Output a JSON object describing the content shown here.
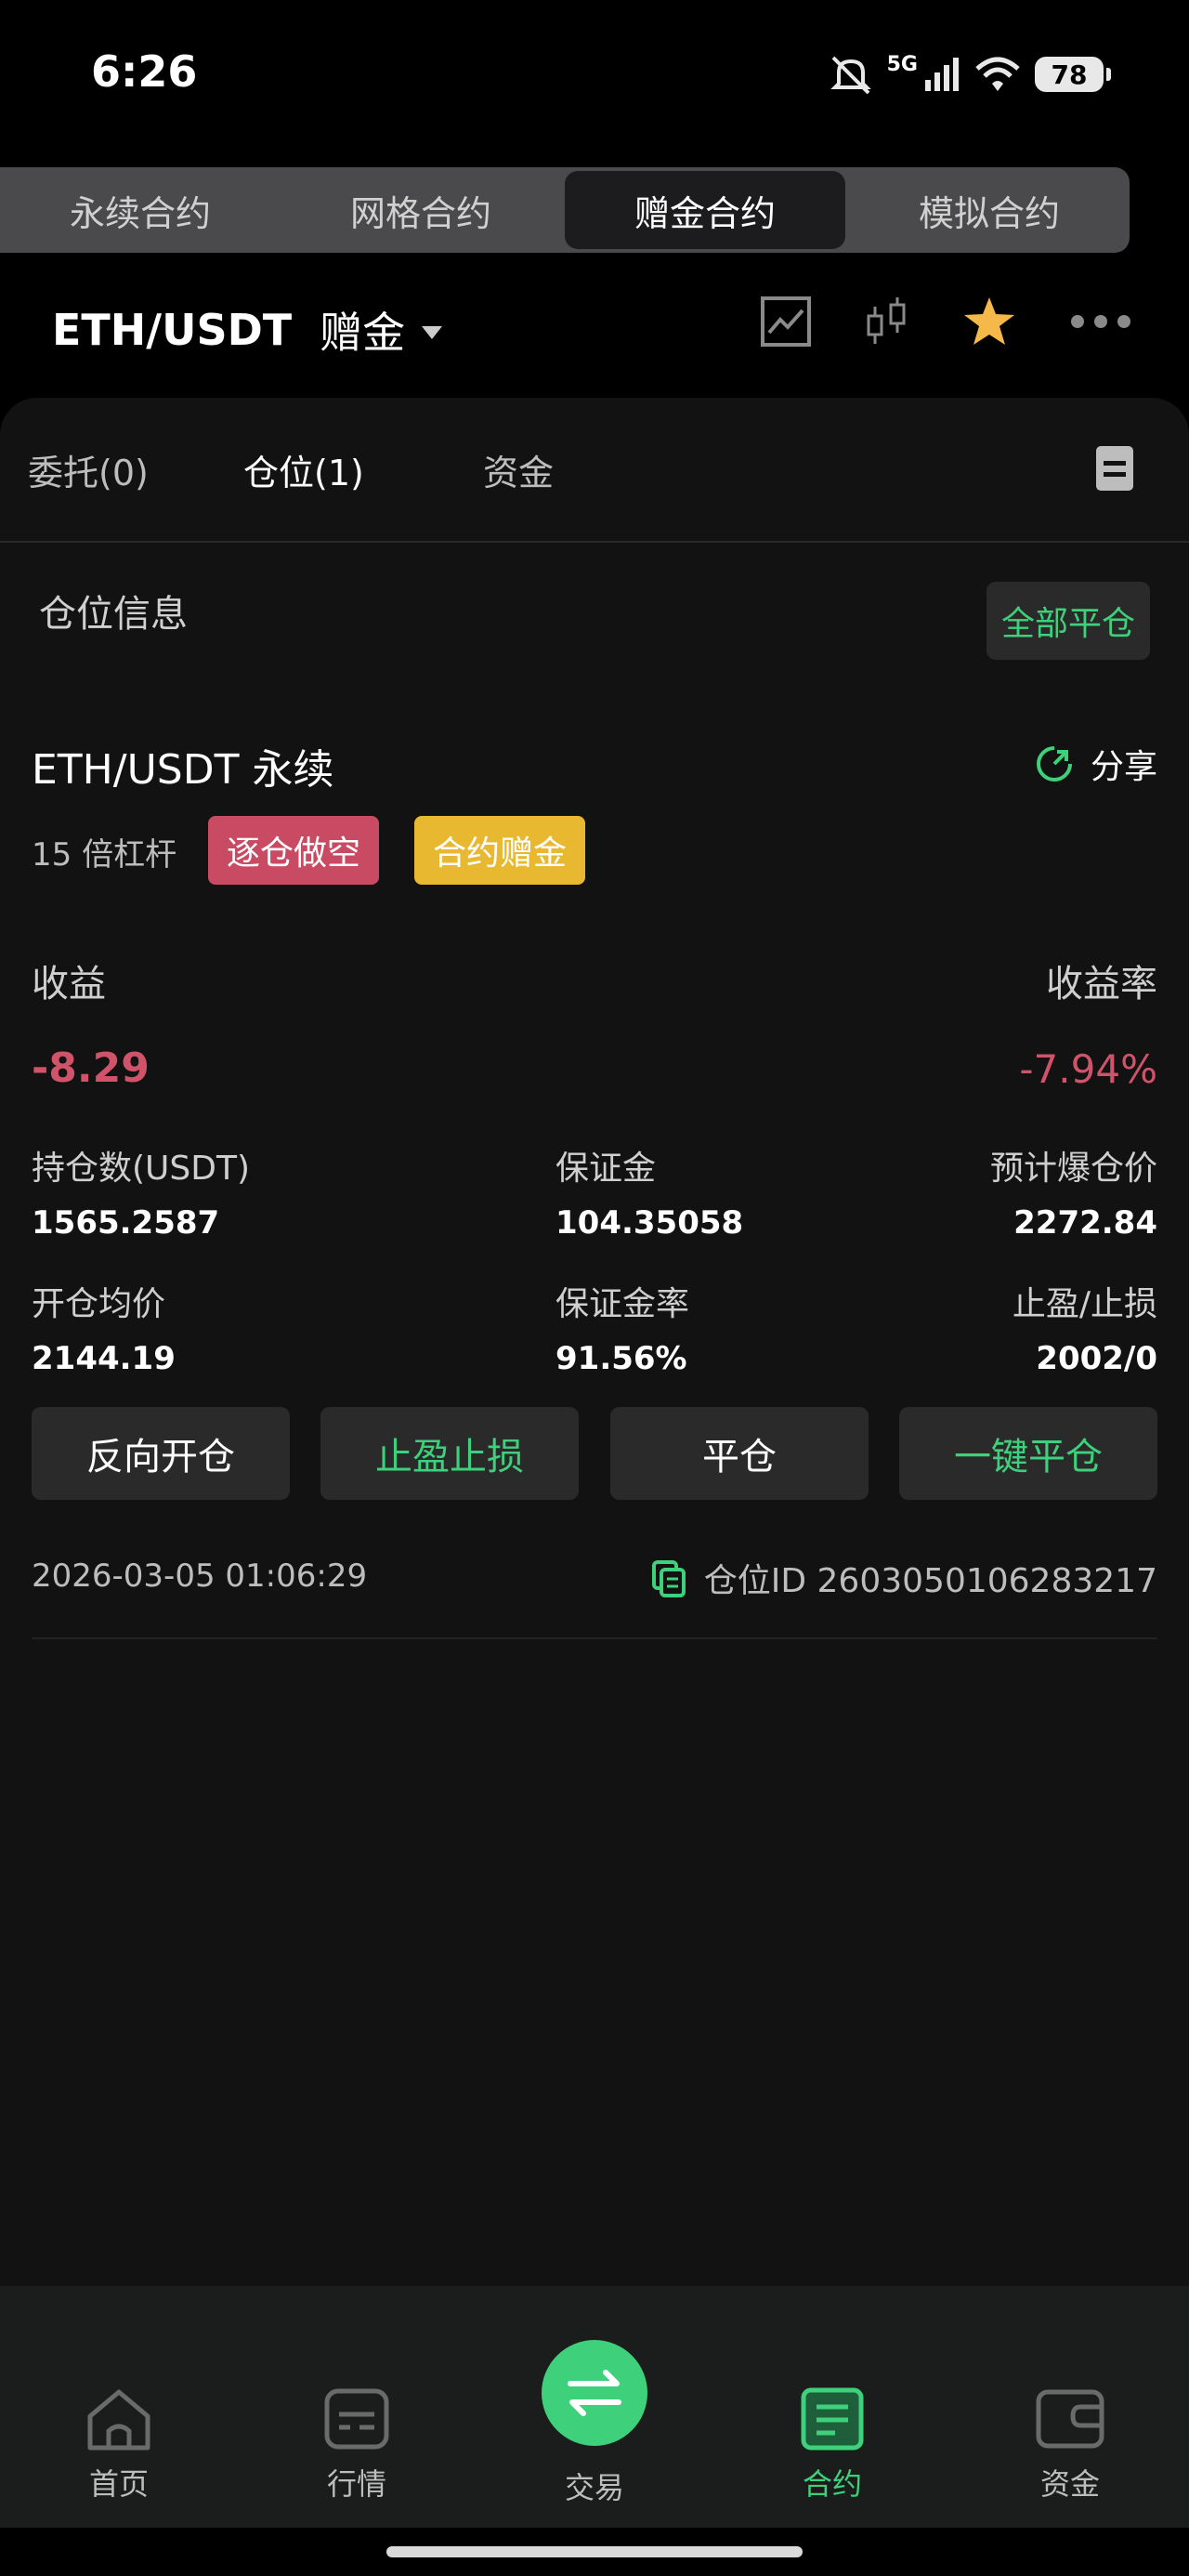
{
  "status_bar": {
    "time": "6:26",
    "network": "5G",
    "battery": "78"
  },
  "contract_tabs": [
    "永续合约",
    "网格合约",
    "赠金合约",
    "模拟合约"
  ],
  "contract_tabs_active": "赠金合约",
  "header": {
    "pair": "ETH/USDT",
    "type": "赠金"
  },
  "tabs": {
    "orders": "委托(0)",
    "positions": "仓位(1)",
    "funds": "资金",
    "active": "positions"
  },
  "section": {
    "title": "仓位信息",
    "close_all": "全部平仓"
  },
  "position": {
    "title": "ETH/USDT 永续",
    "share": "分享",
    "leverage": "15 倍杠杆",
    "badge_mode": "逐仓做空",
    "badge_bonus": "合约赠金",
    "pnl_label": "收益",
    "pnl_value": "-8.29",
    "rate_label": "收益率",
    "rate_value": "-7.94%",
    "size_label": "持仓数(USDT)",
    "size_value": "1565.2587",
    "margin_label": "保证金",
    "margin_value": "104.35058",
    "liq_label": "预计爆仓价",
    "liq_value": "2272.84",
    "entry_label": "开仓均价",
    "entry_value": "2144.19",
    "margin_rate_label": "保证金率",
    "margin_rate_value": "91.56%",
    "tpsl_label": "止盈/止损",
    "tpsl_value": "2002/0",
    "actions": {
      "reverse": "反向开仓",
      "tpsl": "止盈止损",
      "close": "平仓",
      "one_click": "一键平仓"
    },
    "timestamp": "2026-03-05 01:06:29",
    "position_id": "仓位ID 2603050106283217"
  },
  "bottom_nav": {
    "home": "首页",
    "market": "行情",
    "trade": "交易",
    "contract": "合约",
    "assets": "资金",
    "active": "合约"
  },
  "colors": {
    "green": "#3ed07a",
    "red": "#d1536a",
    "gold": "#e8b930",
    "star": "#f5b94a"
  }
}
